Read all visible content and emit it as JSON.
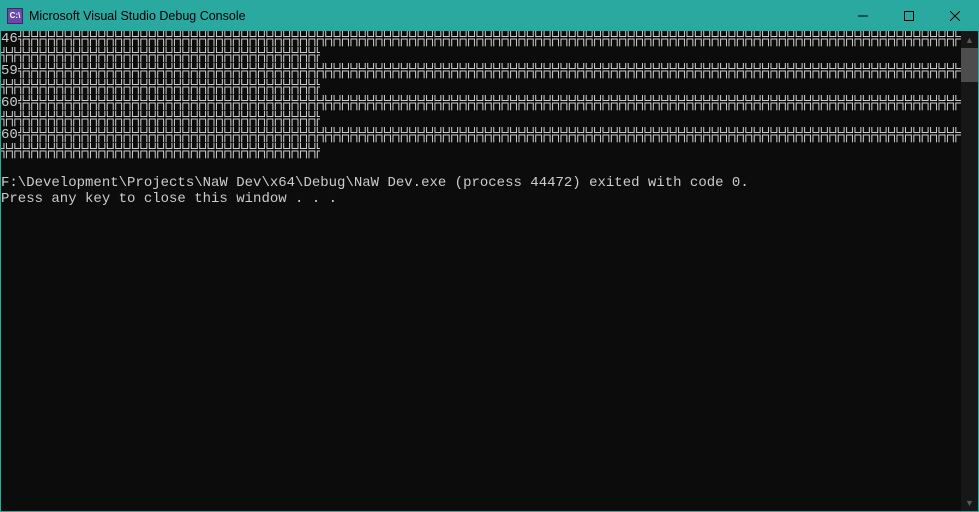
{
  "window": {
    "title": "Microsoft Visual Studio Debug Console",
    "app_icon_text": "C:\\"
  },
  "bars": {
    "long_len": 130,
    "short_len": 38,
    "char": "╬",
    "rows": [
      {
        "label": "46",
        "kind": "long"
      },
      {
        "label": "",
        "kind": "short"
      },
      {
        "label": "59",
        "kind": "long"
      },
      {
        "label": "",
        "kind": "short"
      },
      {
        "label": "60",
        "kind": "long"
      },
      {
        "label": "",
        "kind": "short"
      },
      {
        "label": "60",
        "kind": "long"
      },
      {
        "label": "",
        "kind": "short"
      }
    ]
  },
  "output": {
    "blank": "",
    "exit_line": "F:\\Development\\Projects\\NaW Dev\\x64\\Debug\\NaW Dev.exe (process 44472) exited with code 0.",
    "press_line": "Press any key to close this window . . ."
  },
  "scroll": {
    "up_glyph": "▲",
    "down_glyph": "▼"
  }
}
